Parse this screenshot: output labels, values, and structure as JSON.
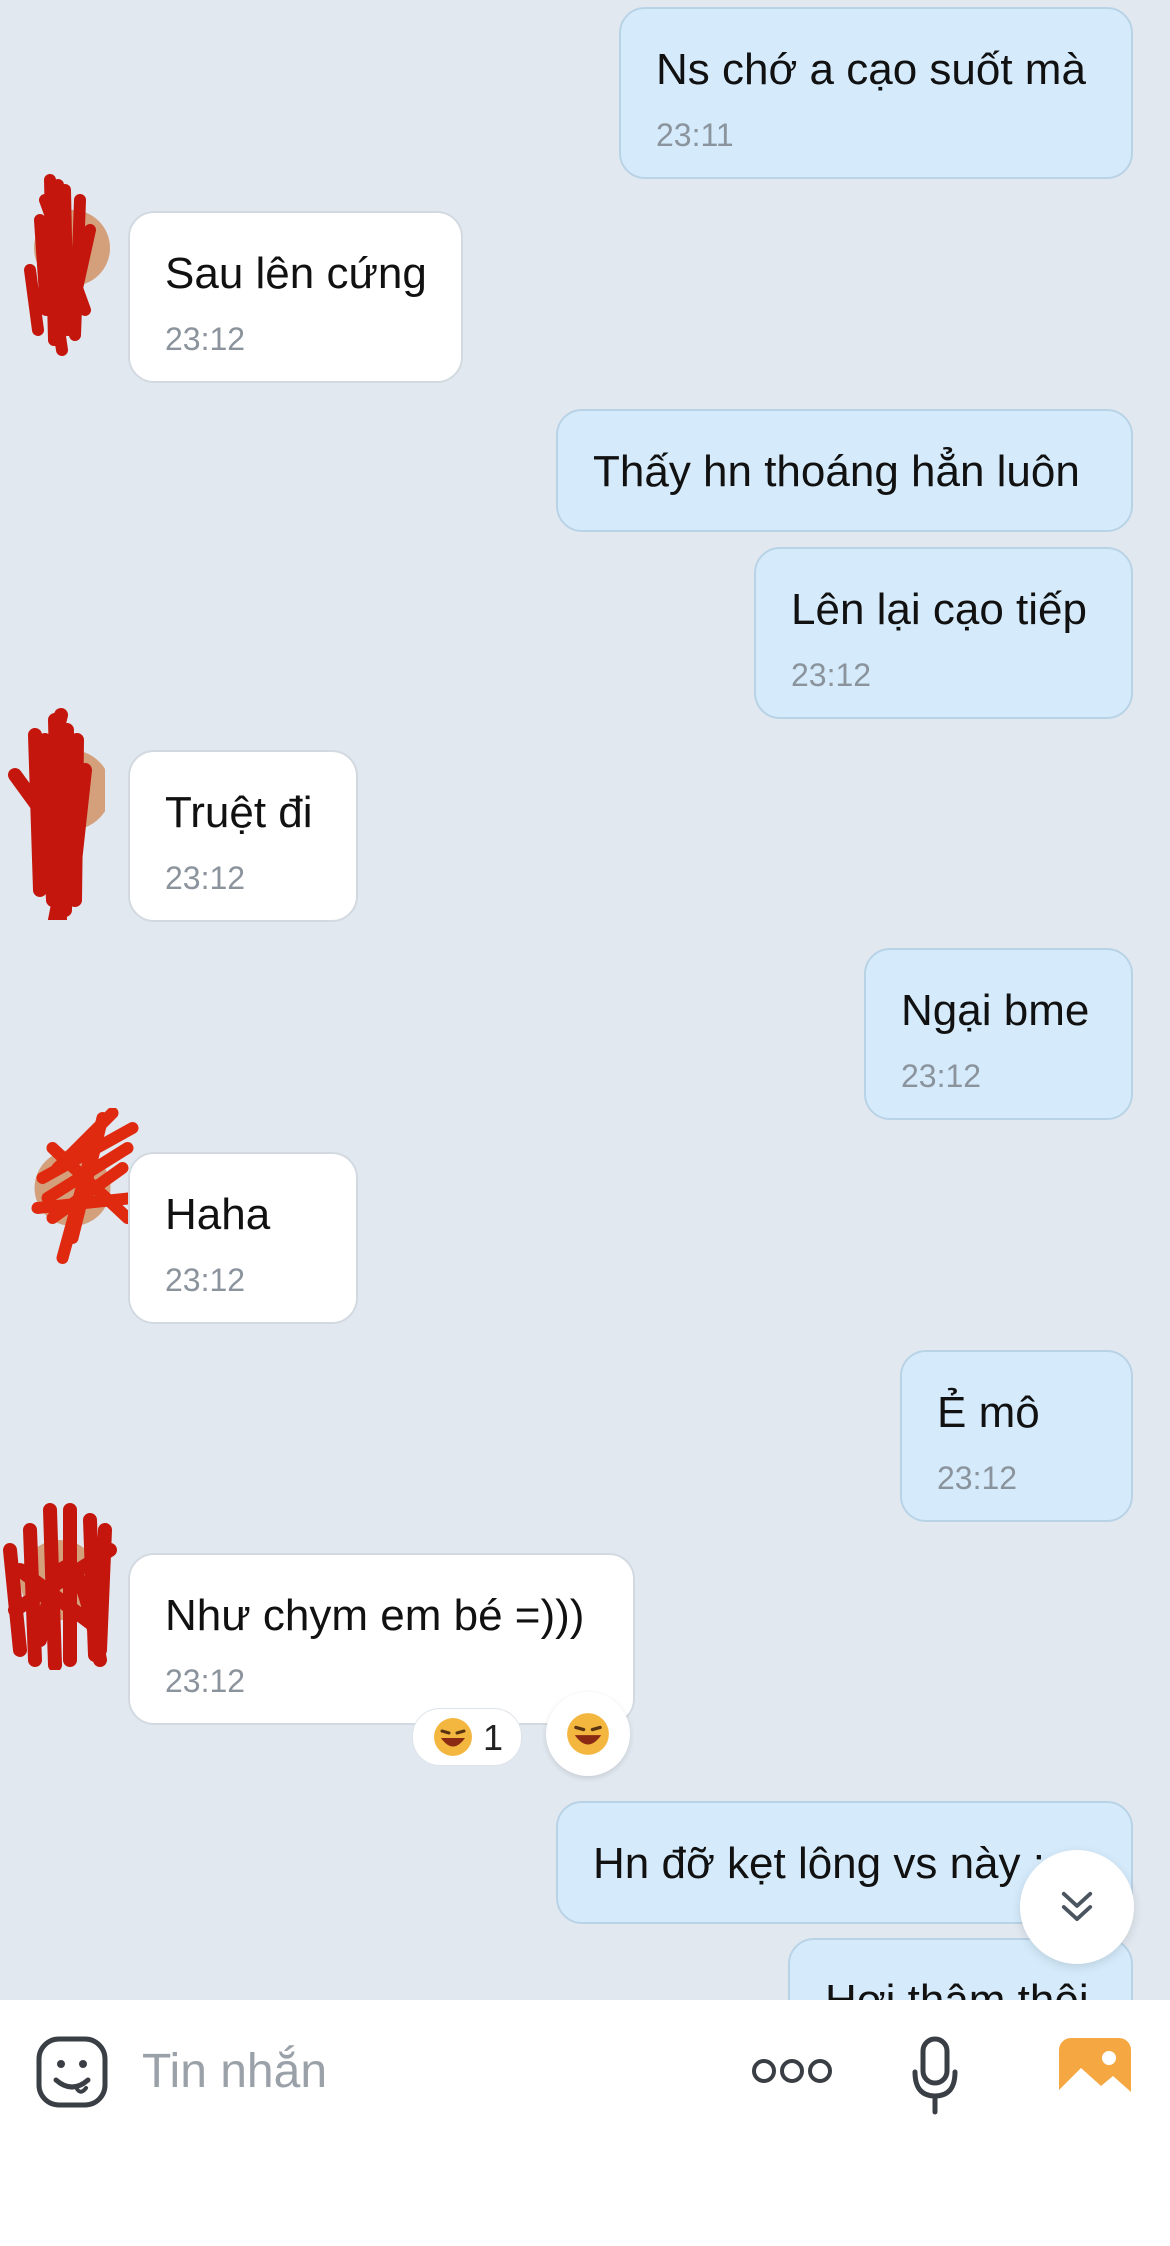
{
  "messages": [
    {
      "side": "out",
      "text": "Ns chớ a cạo suốt mà",
      "time": "23:11"
    },
    {
      "side": "in",
      "text": "Sau lên cứng",
      "time": "23:12"
    },
    {
      "side": "out",
      "text": "Thấy hn thoáng hẳn luôn",
      "time": ""
    },
    {
      "side": "out",
      "text": "Lên lại cạo tiếp",
      "time": "23:12"
    },
    {
      "side": "in",
      "text": "Truệt đi",
      "time": "23:12"
    },
    {
      "side": "out",
      "text": "Ngại bme",
      "time": "23:12"
    },
    {
      "side": "in",
      "text": "Haha",
      "time": "23:12"
    },
    {
      "side": "out",
      "text": "Ẻ mô",
      "time": "23:12"
    },
    {
      "side": "in",
      "text": "Như chym em bé =)))",
      "time": "23:12"
    },
    {
      "side": "out",
      "text": "Hn đỡ kẹt lông vs này :",
      "time": ""
    },
    {
      "side": "out",
      "text": "Hơi thâm thôi",
      "time": ""
    }
  ],
  "reaction": {
    "emoji": "laughing-face-icon",
    "count": "1"
  },
  "composer": {
    "placeholder": "Tin nhắn"
  },
  "colors": {
    "chat_bg": "#e2e8f0",
    "outgoing_bubble": "#d5ebfb",
    "incoming_bubble": "#ffffff",
    "gallery_accent": "#f5a742"
  }
}
